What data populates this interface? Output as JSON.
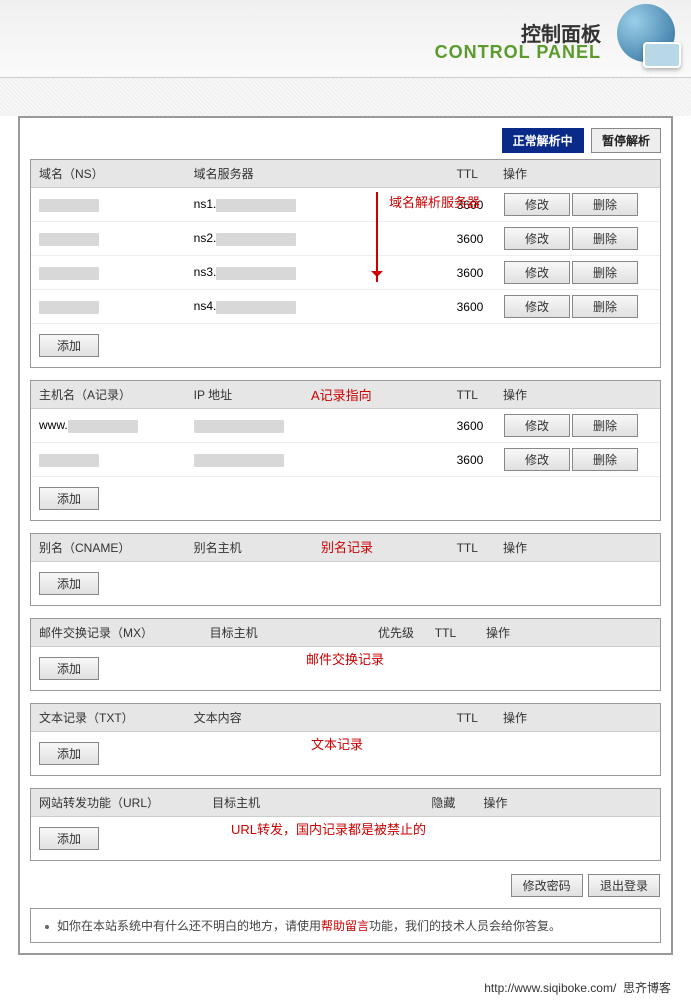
{
  "header": {
    "title_cn": "控制面板",
    "title_en": "CONTROL PANEL"
  },
  "status": {
    "active": "正常解析中",
    "pause": "暂停解析"
  },
  "btns": {
    "modify": "修改",
    "delete": "删除",
    "add": "添加",
    "chpwd": "修改密码",
    "logout": "退出登录"
  },
  "ns": {
    "cols": {
      "host": "域名（NS）",
      "target": "域名服务器",
      "ttl": "TTL",
      "ops": "操作"
    },
    "rows": [
      {
        "ttl": "3600",
        "pre": "ns1."
      },
      {
        "ttl": "3600",
        "pre": "ns2."
      },
      {
        "ttl": "3600",
        "pre": "ns3."
      },
      {
        "ttl": "3600",
        "pre": "ns4."
      }
    ],
    "anno": "域名解析服务器"
  },
  "a": {
    "cols": {
      "host": "主机名（A记录）",
      "target": "IP 地址",
      "ttl": "TTL",
      "ops": "操作"
    },
    "rows": [
      {
        "pre": "www.",
        "ttl": "3600"
      },
      {
        "pre": "",
        "ttl": "3600"
      }
    ],
    "anno": "A记录指向"
  },
  "cname": {
    "cols": {
      "host": "别名（CNAME）",
      "target": "别名主机",
      "ttl": "TTL",
      "ops": "操作"
    },
    "anno": "别名记录"
  },
  "mx": {
    "cols": {
      "host": "邮件交换记录（MX）",
      "target": "目标主机",
      "pri": "优先级",
      "ttl": "TTL",
      "ops": "操作"
    },
    "anno": "邮件交换记录"
  },
  "txt": {
    "cols": {
      "host": "文本记录（TXT）",
      "target": "文本内容",
      "ttl": "TTL",
      "ops": "操作"
    },
    "anno": "文本记录"
  },
  "url": {
    "cols": {
      "host": "网站转发功能（URL）",
      "target": "目标主机",
      "hide": "隐藏",
      "ops": "操作"
    },
    "anno": "URL转发，国内记录都是被禁止的"
  },
  "help": {
    "p1": "如你在本站系统中有什么还不明白的地方，请使用",
    "link": "帮助留言",
    "p2": "功能，我们的技术人员会给你答复。"
  },
  "credit": {
    "url": "http://www.siqiboke.com/",
    "name": "思齐博客"
  }
}
